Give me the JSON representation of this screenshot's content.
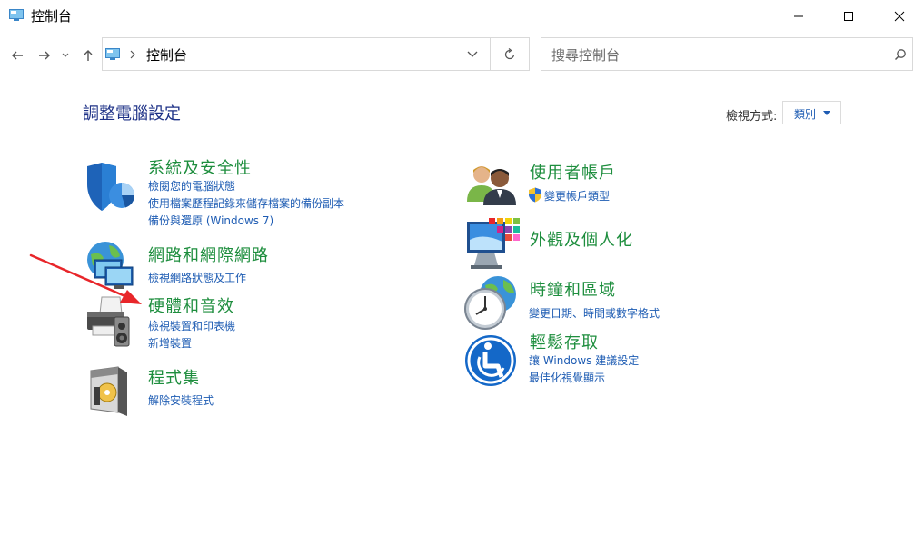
{
  "window": {
    "title": "控制台",
    "minimize": "─",
    "maximize": "☐",
    "close": "✕"
  },
  "nav": {
    "breadcrumb": [
      "控制台"
    ],
    "search_placeholder": "搜尋控制台"
  },
  "main": {
    "heading": "調整電腦設定",
    "view_by_label": "檢視方式:",
    "view_by_value": "類別"
  },
  "categories_left": [
    {
      "title": "系統及安全性",
      "icon": "shield-icon",
      "links": [
        "檢閱您的電腦狀態",
        "使用檔案歷程記錄來儲存檔案的備份副本",
        "備份與還原 (Windows 7)"
      ]
    },
    {
      "title": "網路和網際網路",
      "icon": "network-icon",
      "links": [
        "檢視網路狀態及工作"
      ]
    },
    {
      "title": "硬體和音效",
      "icon": "printer-icon",
      "links": [
        "檢視裝置和印表機",
        "新增裝置"
      ]
    },
    {
      "title": "程式集",
      "icon": "programs-icon",
      "links": [
        "解除安裝程式"
      ]
    }
  ],
  "categories_right": [
    {
      "title": "使用者帳戶",
      "icon": "users-icon",
      "links": [
        "變更帳戶類型"
      ]
    },
    {
      "title": "外觀及個人化",
      "icon": "monitor-icon",
      "links": []
    },
    {
      "title": "時鐘和區域",
      "icon": "clock-icon",
      "links": [
        "變更日期、時間或數字格式"
      ]
    },
    {
      "title": "輕鬆存取",
      "icon": "accessibility-icon",
      "links": [
        "讓 Windows 建議設定",
        "最佳化視覺顯示"
      ]
    }
  ],
  "colors": {
    "accent_link": "#1e5cb3",
    "category_title": "#1e8e3e",
    "heading": "#1e3287",
    "annotation_arrow": "#e8262a"
  }
}
